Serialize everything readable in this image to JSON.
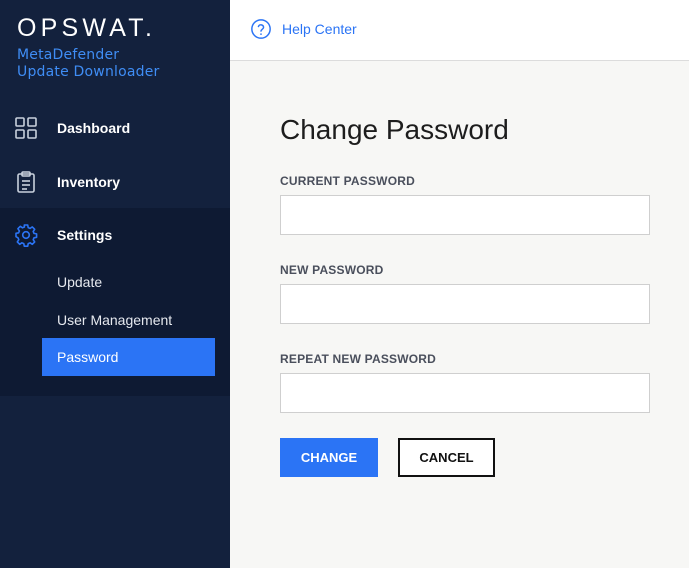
{
  "brand": {
    "logo": "OPSWAT.",
    "product_line1": "MetaDefender",
    "product_line2": "Update Downloader"
  },
  "sidebar": {
    "items": [
      {
        "label": "Dashboard",
        "icon": "dashboard-grid-icon"
      },
      {
        "label": "Inventory",
        "icon": "clipboard-icon"
      },
      {
        "label": "Settings",
        "icon": "gear-icon",
        "active": true
      }
    ],
    "settings_submenu": [
      {
        "label": "Update"
      },
      {
        "label": "User Management"
      },
      {
        "label": "Password",
        "active": true
      }
    ]
  },
  "topbar": {
    "help_label": "Help Center",
    "help_icon": "question-circle-icon"
  },
  "main": {
    "title": "Change Password",
    "fields": [
      {
        "label": "CURRENT PASSWORD",
        "value": "",
        "placeholder": ""
      },
      {
        "label": "NEW PASSWORD",
        "value": "",
        "placeholder": ""
      },
      {
        "label": "REPEAT NEW PASSWORD",
        "value": "",
        "placeholder": ""
      }
    ],
    "change_label": "CHANGE",
    "cancel_label": "CANCEL"
  },
  "colors": {
    "sidebar_bg": "#13213d",
    "accent": "#2b74f5",
    "page_bg": "#f7f7f5"
  }
}
